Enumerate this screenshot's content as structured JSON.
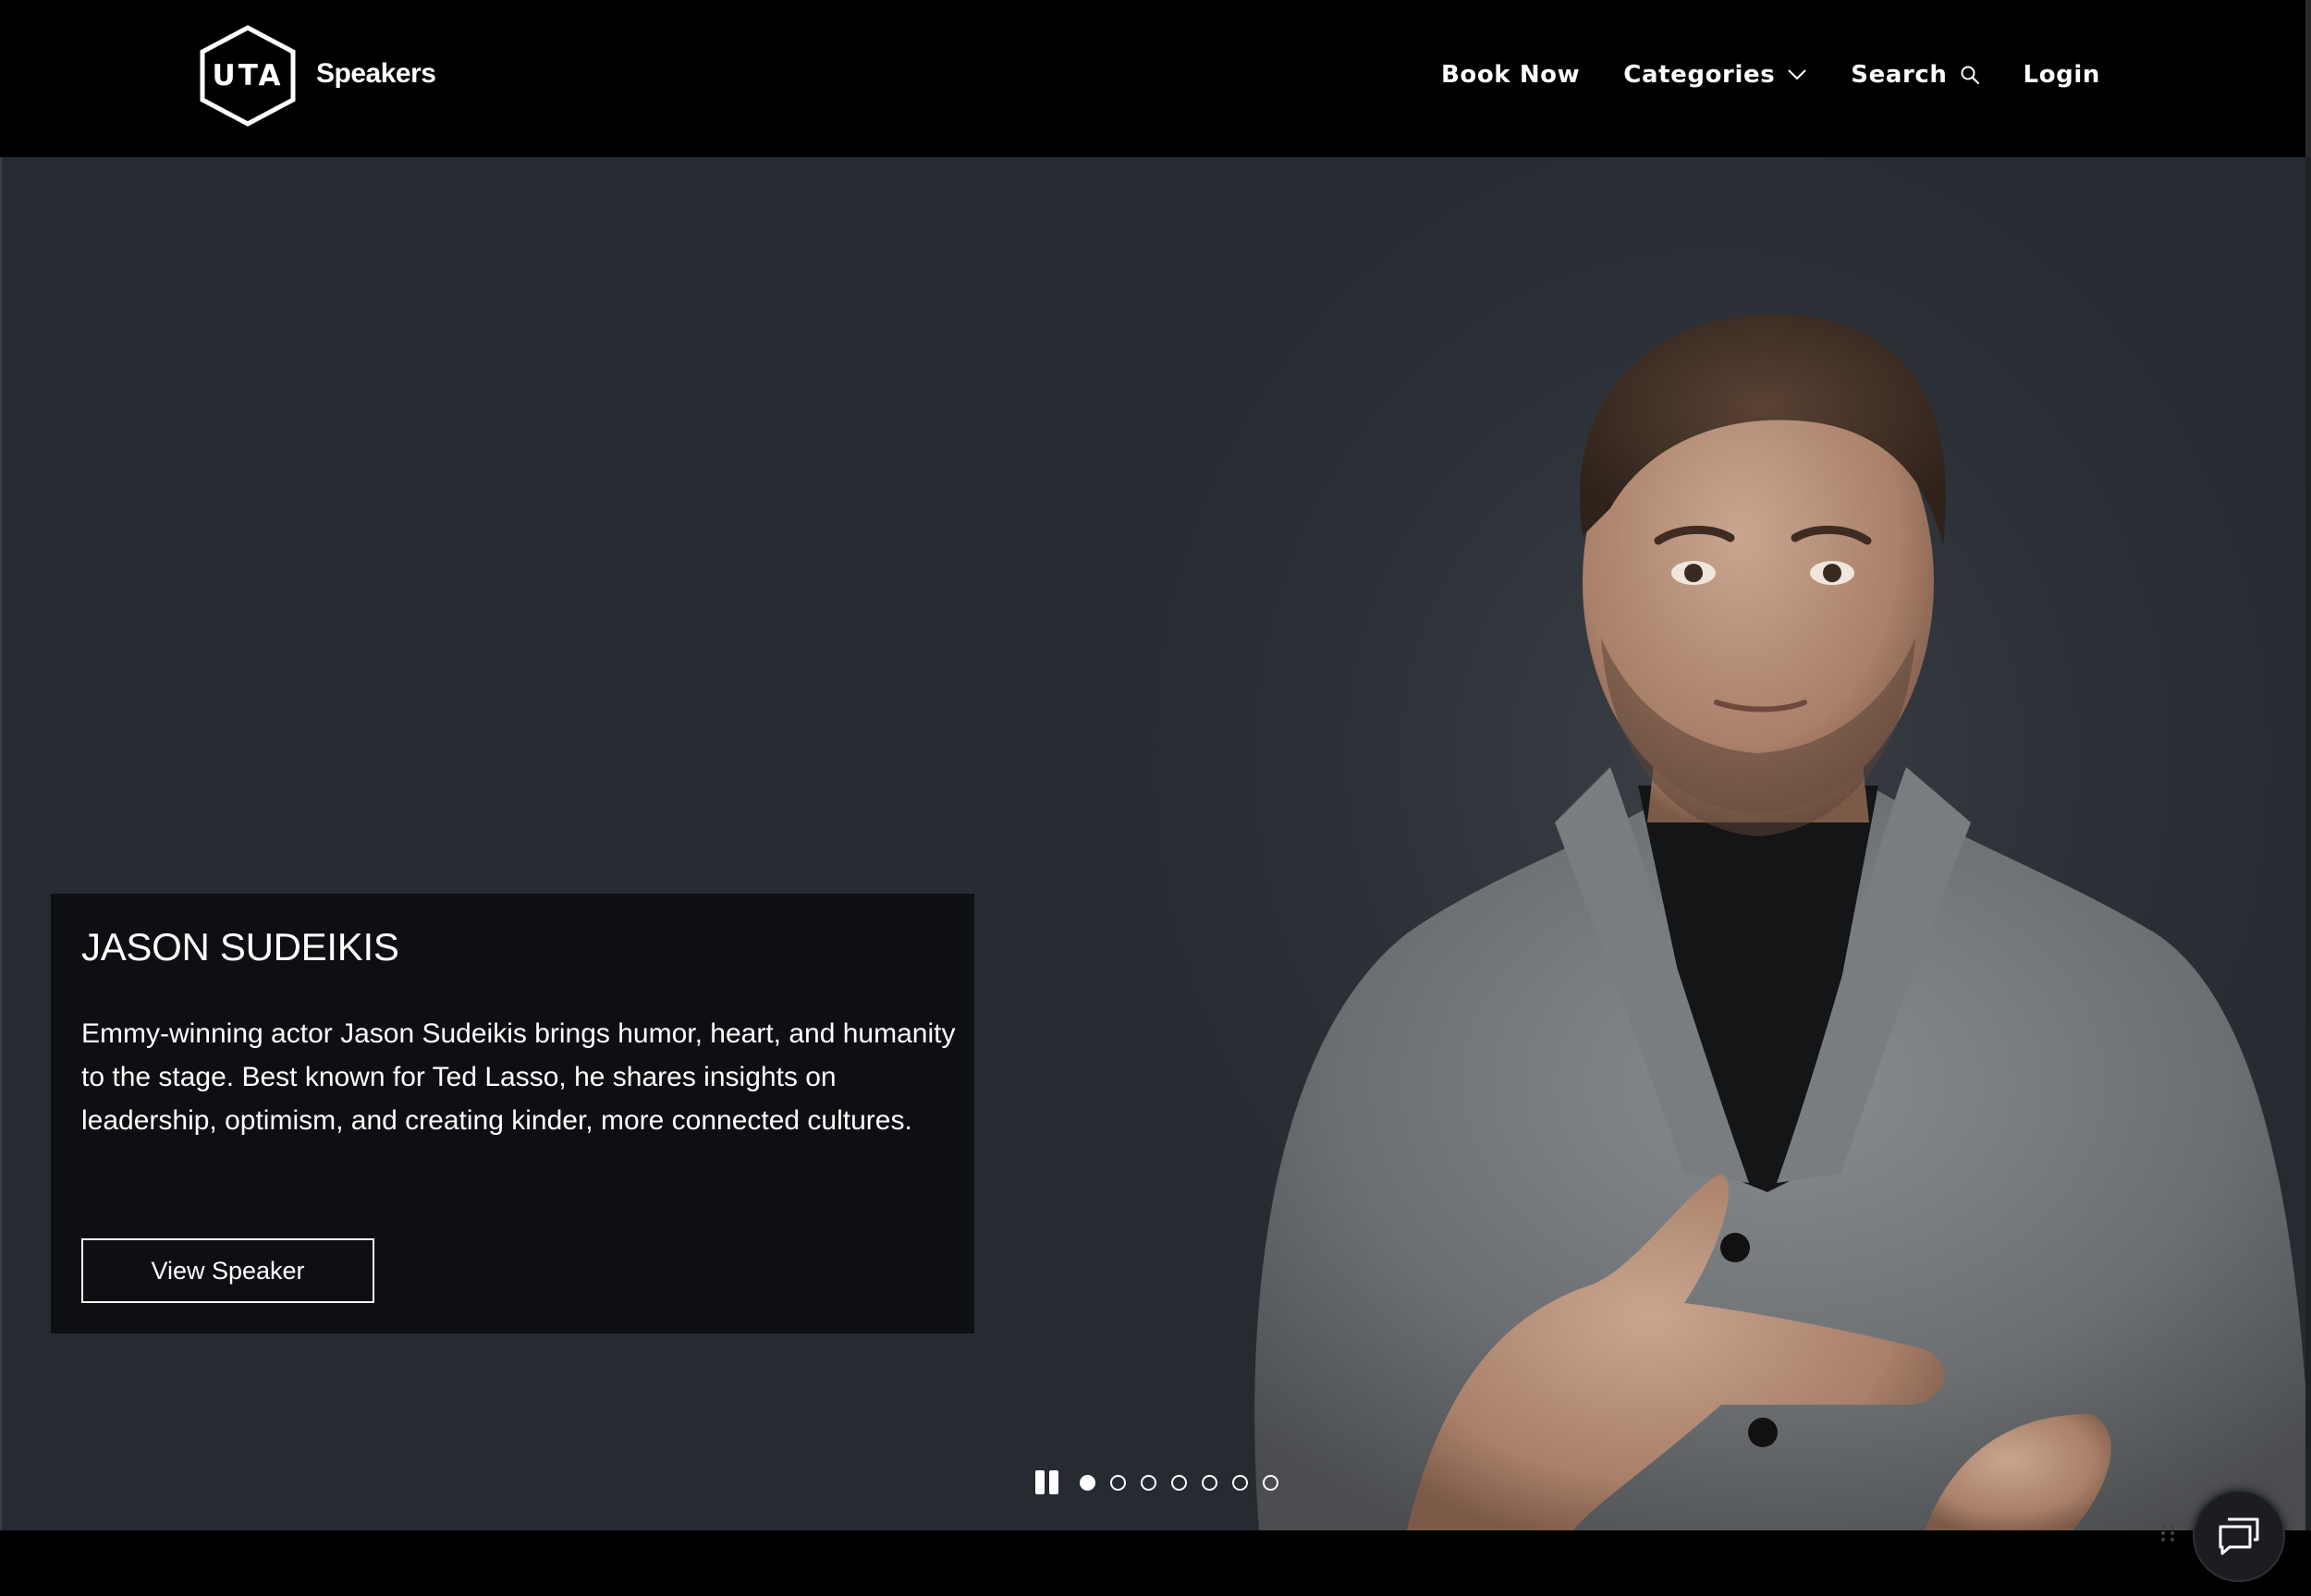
{
  "header": {
    "logo_text": "UTA",
    "brand_name": "Speakers",
    "nav": {
      "book_now": "Book Now",
      "categories": "Categories",
      "search": "Search",
      "login": "Login"
    }
  },
  "hero": {
    "speaker_name": "JASON SUDEIKIS",
    "description": "Emmy-winning actor Jason Sudeikis brings humor, heart, and humanity to the stage. Best known for Ted Lasso, he shares insights on leadership, optimism, and creating kinder, more connected cultures.",
    "cta_label": "View Speaker"
  },
  "carousel": {
    "total_slides": 7,
    "active_slide": 1
  },
  "icons": {
    "categories": "chevron-down-icon",
    "search": "search-icon",
    "pause": "pause-icon",
    "chat": "chat-icon"
  },
  "colors": {
    "header_bg": "#000000",
    "hero_bg": "#262b32",
    "card_bg": "#0d0f12",
    "text": "#ffffff"
  }
}
